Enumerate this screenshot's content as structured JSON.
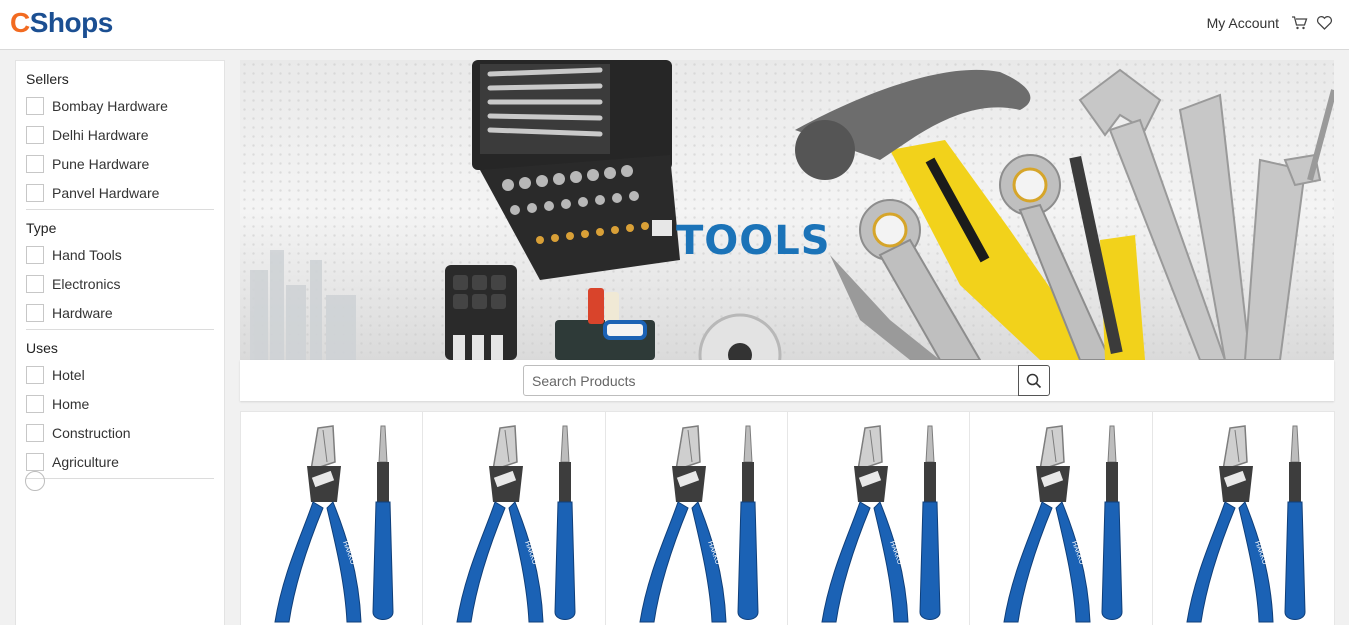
{
  "header": {
    "logo_c": "C",
    "logo_rest": "Shops",
    "account_label": "My Account",
    "icons": [
      "cart-icon",
      "heart-icon"
    ]
  },
  "filters": {
    "sellers": {
      "title": "Sellers",
      "options": [
        "Bombay Hardware",
        "Delhi Hardware",
        "Pune Hardware",
        "Panvel Hardware"
      ]
    },
    "type": {
      "title": "Type",
      "options": [
        "Hand Tools",
        "Electronics",
        "Hardware"
      ]
    },
    "uses": {
      "title": "Uses",
      "options": [
        "Hotel",
        "Home",
        "Construction",
        "Agriculture"
      ]
    }
  },
  "banner": {
    "title": "TOOLS"
  },
  "search": {
    "placeholder": "Search Products",
    "value": ""
  },
  "products": {
    "count": 6
  },
  "colors": {
    "logo_orange": "#f26b21",
    "logo_blue": "#1b4f92",
    "banner_text": "#1b73b8",
    "plier_handle": "#1b62b5",
    "hammer_yellow": "#f2d21b"
  }
}
